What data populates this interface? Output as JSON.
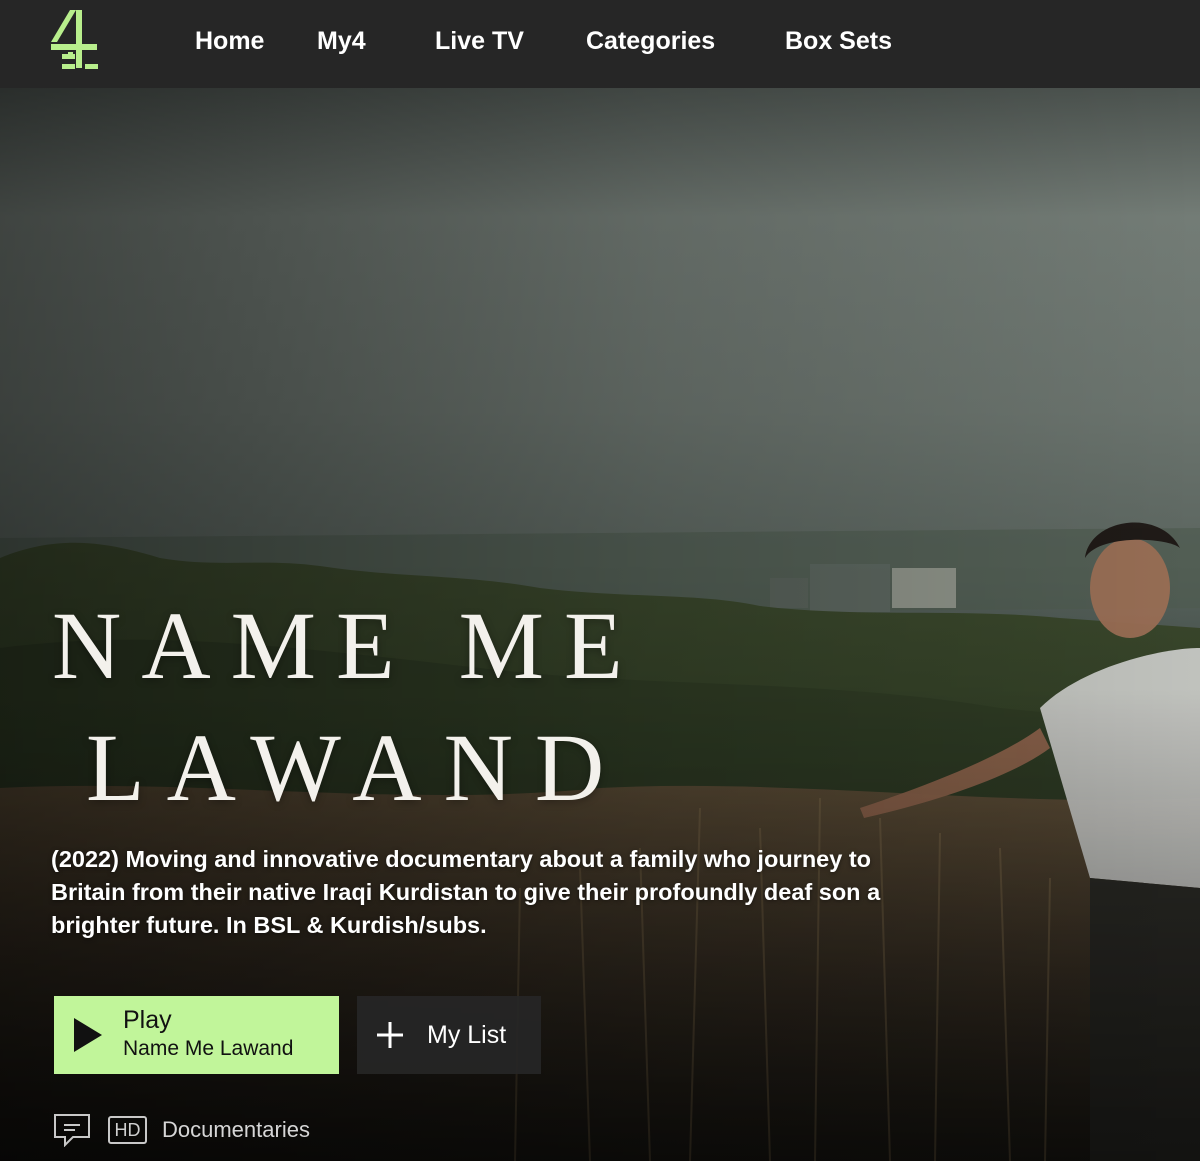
{
  "brand": {
    "logo_icon": "channel4-logo-icon",
    "accent_color": "#c1f59a",
    "nav_bg": "#262626"
  },
  "nav": {
    "items": [
      {
        "label": "Home"
      },
      {
        "label": "My4"
      },
      {
        "label": "Live TV"
      },
      {
        "label": "Categories"
      },
      {
        "label": "Box Sets"
      }
    ]
  },
  "hero": {
    "title_line_1": "NAME ME",
    "title_line_2": "LAWAND",
    "description": "(2022) Moving and innovative documentary about a family who journey to Britain from their native Iraqi Kurdistan to give their profoundly deaf son a brighter future. In BSL & Kurdish/subs.",
    "play_button": {
      "label": "Play",
      "subtitle": "Name Me Lawand",
      "icon": "play-icon"
    },
    "mylist_button": {
      "label": "My List",
      "icon": "plus-icon"
    },
    "meta": {
      "subtitles_icon": "subtitles-icon",
      "hd_badge": "HD",
      "genre": "Documentaries"
    }
  }
}
